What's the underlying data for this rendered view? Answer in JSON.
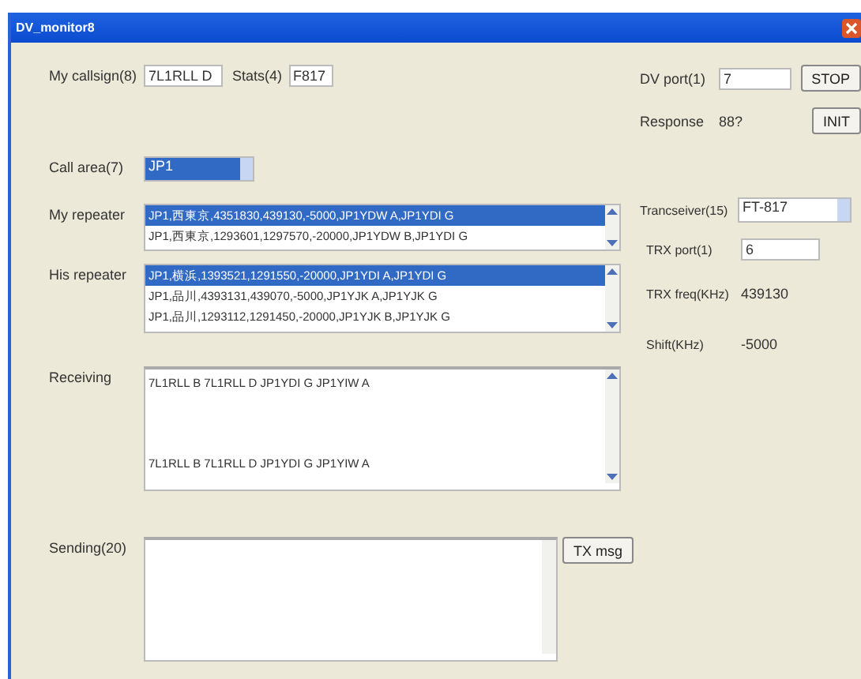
{
  "window": {
    "title": "DV_monitor8"
  },
  "callsign": {
    "label": "My callsign(8)",
    "value": "7L1RLL D"
  },
  "stats": {
    "label": "Stats(4)",
    "value": "F817"
  },
  "dv_port": {
    "label": "DV port(1)",
    "value": "7"
  },
  "stop_button": "STOP",
  "response": {
    "label": "Response",
    "value": "88?"
  },
  "init_button": "INIT",
  "call_area": {
    "label": "Call area(7)",
    "value": "JP1"
  },
  "my_repeater": {
    "label": "My repeater",
    "items": [
      {
        "text": "JP1,西東京,4351830,439130,-5000,JP1YDW A,JP1YDI G",
        "selected": true
      },
      {
        "text": "JP1,西東京,1293601,1297570,-20000,JP1YDW B,JP1YDI G",
        "selected": false
      }
    ]
  },
  "transceiver": {
    "label": "Trancseiver(15)",
    "value": "FT-817"
  },
  "his_repeater": {
    "label": "His repeater",
    "items": [
      {
        "text": "JP1,横浜,1393521,1291550,-20000,JP1YDI A,JP1YDI G",
        "selected": true
      },
      {
        "text": "JP1,品川,4393131,439070,-5000,JP1YJK A,JP1YJK G",
        "selected": false
      },
      {
        "text": "JP1,品川,1293112,1291450,-20000,JP1YJK B,JP1YJK G",
        "selected": false
      }
    ]
  },
  "trx_port": {
    "label": "TRX port(1)",
    "value": "6"
  },
  "trx_freq": {
    "label": "TRX freq(KHz)",
    "value": "439130"
  },
  "shift": {
    "label": "Shift(KHz)",
    "value": "-5000"
  },
  "receiving": {
    "label": "Receiving",
    "lines": [
      "7L1RLL B 7L1RLL D JP1YDI G JP1YIW A",
      "7L1RLL B 7L1RLL D JP1YDI G JP1YIW A"
    ]
  },
  "sending": {
    "label": "Sending(20)"
  },
  "tx_button": "TX msg"
}
